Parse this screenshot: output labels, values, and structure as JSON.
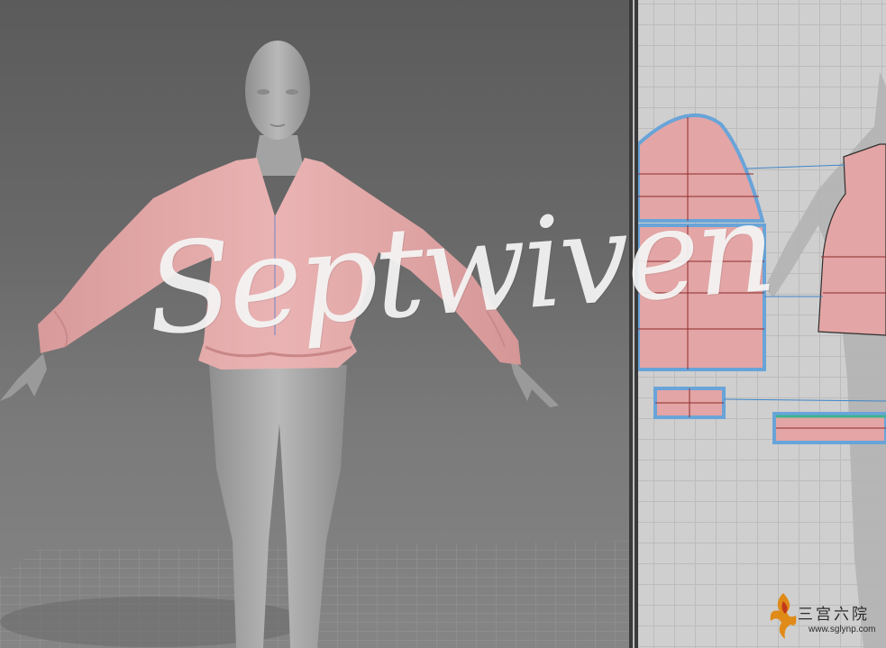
{
  "app": {
    "views": [
      {
        "name": "3d-avatar-window"
      },
      {
        "name": "2d-pattern-window"
      }
    ]
  },
  "watermark": {
    "text": "Septwiven"
  },
  "site_logo": {
    "chinese_text": "三宫六院",
    "url_text": "www.sglynp.com"
  },
  "colors": {
    "viewport_bg": "#6a6a6a",
    "pattern_bg": "#cfcfcf",
    "grid_line": "#bcbcbc",
    "garment_pink": "#e5a9a9",
    "pattern_fill": "#e3a5a5",
    "pattern_outline_selected": "#69a4d8",
    "seam_line": "#3f86c9",
    "avatar_gray": "#a8a8a8"
  }
}
